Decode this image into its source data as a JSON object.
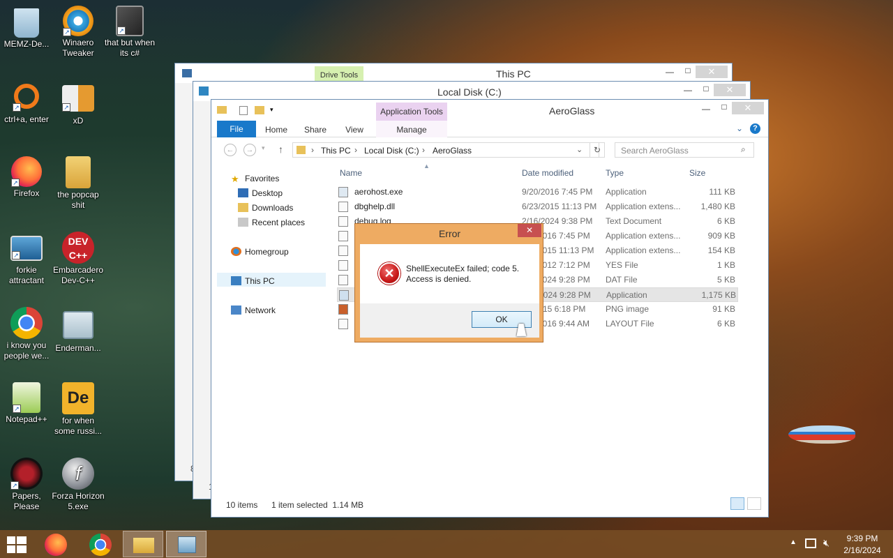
{
  "desktop": {
    "icons": [
      {
        "label": "MEMZ-De...",
        "icon": "recycle-bin-icon"
      },
      {
        "label": "Winaero Tweaker",
        "icon": "winaero-tweaker-icon"
      },
      {
        "label": "that but when its c#",
        "icon": "stacked-windows-icon"
      },
      {
        "label": "ctrl+a, enter",
        "icon": "magnifier-icon"
      },
      {
        "label": "xD",
        "icon": "hxd-icon"
      },
      {
        "label": "Firefox",
        "icon": "firefox-icon"
      },
      {
        "label": "the popcap shit",
        "icon": "popcap-folder-icon"
      },
      {
        "label": "forkie attractant",
        "icon": "computer-settings-icon"
      },
      {
        "label": "Embarcadero Dev-C++",
        "icon": "devcpp-icon"
      },
      {
        "label": "i know you people we...",
        "icon": "chrome-icon"
      },
      {
        "label": "Enderman...",
        "icon": "window-app-icon"
      },
      {
        "label": "Notepad++",
        "icon": "notepadpp-icon"
      },
      {
        "label": "for when some russi...",
        "icon": "de-icon"
      },
      {
        "label": "Papers, Please",
        "icon": "papers-please-icon"
      },
      {
        "label": "Forza Horizon 5.exe",
        "icon": "flash-icon"
      }
    ]
  },
  "windows": {
    "back": {
      "title": "This PC",
      "context_tab": "Drive Tools",
      "status_fragment": "8"
    },
    "middle": {
      "title": "Local Disk (C:)",
      "status_fragment": "1"
    },
    "front": {
      "title": "AeroGlass",
      "context_tab": "Application Tools",
      "ribbon_tabs": [
        "File",
        "Home",
        "Share",
        "View",
        "Manage"
      ],
      "breadcrumb": [
        "This PC",
        "Local Disk (C:)",
        "AeroGlass"
      ],
      "search_placeholder": "Search AeroGlass",
      "columns": {
        "name": "Name",
        "date": "Date modified",
        "type": "Type",
        "size": "Size"
      },
      "nav": {
        "favorites": "Favorites",
        "desktop": "Desktop",
        "downloads": "Downloads",
        "recent": "Recent places",
        "homegroup": "Homegroup",
        "thispc": "This PC",
        "network": "Network"
      },
      "files": [
        {
          "name": "aerohost.exe",
          "date": "9/20/2016 7:45 PM",
          "type": "Application",
          "size": "111 KB"
        },
        {
          "name": "dbghelp.dll",
          "date": "6/23/2015 11:13 PM",
          "type": "Application extens...",
          "size": "1,480 KB"
        },
        {
          "name": "debug.log",
          "date": "2/16/2024 9:38 PM",
          "type": "Text Document",
          "size": "6 KB"
        },
        {
          "name": "",
          "date": "2016 7:45 PM",
          "type": "Application extens...",
          "size": "909 KB"
        },
        {
          "name": "",
          "date": "2015 11:13 PM",
          "type": "Application extens...",
          "size": "154 KB"
        },
        {
          "name": "",
          "date": "2012 7:12 PM",
          "type": "YES File",
          "size": "1 KB"
        },
        {
          "name": "",
          "date": "2024 9:28 PM",
          "type": "DAT File",
          "size": "5 KB"
        },
        {
          "name": "",
          "date": "2024 9:28 PM",
          "type": "Application",
          "size": "1,175 KB"
        },
        {
          "name": "",
          "date": "15 6:18 PM",
          "type": "PNG image",
          "size": "91 KB"
        },
        {
          "name": "",
          "date": "2016 9:44 AM",
          "type": "LAYOUT File",
          "size": "6 KB"
        }
      ],
      "status": {
        "count": "10 items",
        "selection": "1 item selected  1.14 MB"
      }
    }
  },
  "dialog": {
    "title": "Error",
    "message_line1": "ShellExecuteEx failed; code 5.",
    "message_line2": "Access is denied.",
    "ok_label": "OK",
    "close_glyph": "✕"
  },
  "taskbar": {
    "start_icon": "windows-start-icon",
    "pinned": [
      "firefox-icon",
      "chrome-icon",
      "file-explorer-icon",
      "app-icon"
    ],
    "time": "9:39 PM",
    "date": "2/16/2024"
  },
  "colors": {
    "accent": "#1979ca",
    "dialog_frame": "#e8a35a",
    "close_red": "#c75050"
  }
}
